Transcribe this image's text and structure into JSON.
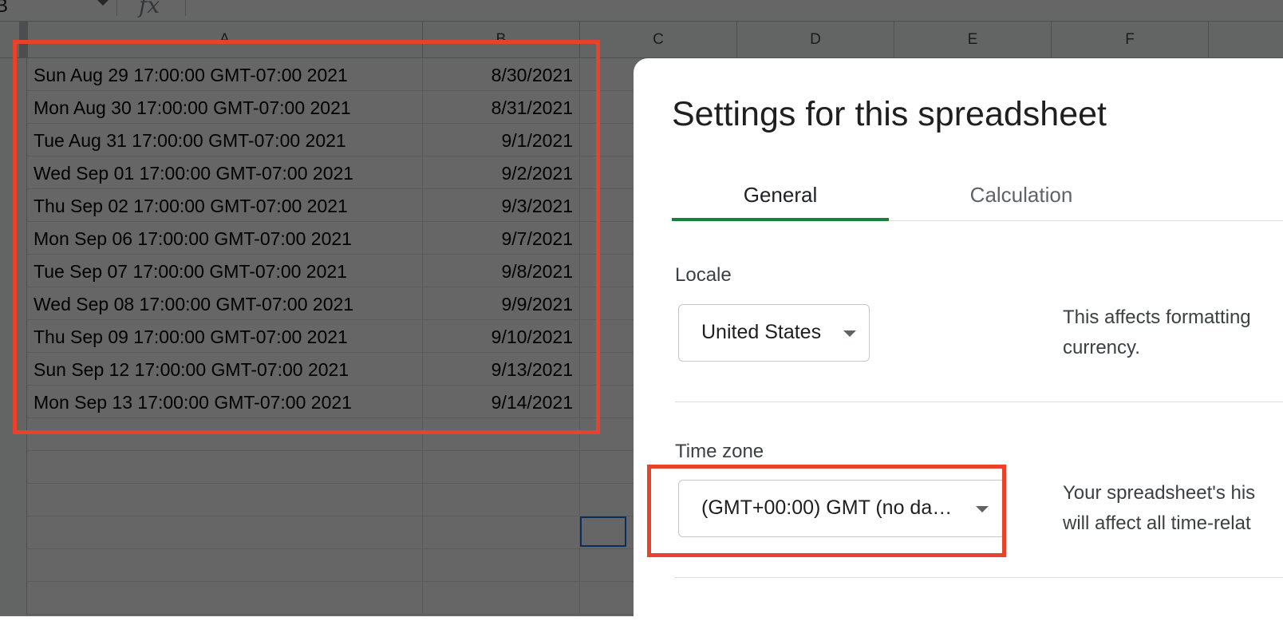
{
  "formula_bar": {
    "name_box_value": "B",
    "fx_symbol": "fx"
  },
  "columns": [
    "A",
    "B",
    "C",
    "D",
    "E",
    "F"
  ],
  "rows": [
    {
      "a": "Sun Aug 29 17:00:00 GMT-07:00 2021",
      "b": "8/30/2021"
    },
    {
      "a": "Mon Aug 30 17:00:00 GMT-07:00 2021",
      "b": "8/31/2021"
    },
    {
      "a": "Tue Aug 31 17:00:00 GMT-07:00 2021",
      "b": "9/1/2021"
    },
    {
      "a": "Wed Sep 01 17:00:00 GMT-07:00 2021",
      "b": "9/2/2021"
    },
    {
      "a": "Thu Sep 02 17:00:00 GMT-07:00 2021",
      "b": "9/3/2021"
    },
    {
      "a": "Mon Sep 06 17:00:00 GMT-07:00 2021",
      "b": "9/7/2021"
    },
    {
      "a": "Tue Sep 07 17:00:00 GMT-07:00 2021",
      "b": "9/8/2021"
    },
    {
      "a": "Wed Sep 08 17:00:00 GMT-07:00 2021",
      "b": "9/9/2021"
    },
    {
      "a": "Thu Sep 09 17:00:00 GMT-07:00 2021",
      "b": "9/10/2021"
    },
    {
      "a": "Sun Sep 12 17:00:00 GMT-07:00 2021",
      "b": "9/13/2021"
    },
    {
      "a": "Mon Sep 13 17:00:00 GMT-07:00 2021",
      "b": "9/14/2021"
    },
    {
      "a": "",
      "b": ""
    },
    {
      "a": "",
      "b": ""
    },
    {
      "a": "",
      "b": ""
    },
    {
      "a": "",
      "b": ""
    },
    {
      "a": "",
      "b": ""
    },
    {
      "a": "",
      "b": ""
    }
  ],
  "dialog": {
    "title": "Settings for this spreadsheet",
    "tabs": [
      {
        "label": "General",
        "active": true
      },
      {
        "label": "Calculation",
        "active": false
      }
    ],
    "locale": {
      "label": "Locale",
      "value": "United States",
      "description_line1": "This affects formatting",
      "description_line2": "currency."
    },
    "timezone": {
      "label": "Time zone",
      "value": "(GMT+00:00) GMT (no da…",
      "description_line1": "Your spreadsheet's his",
      "description_line2": "will affect all time-relat"
    }
  },
  "colors": {
    "highlight": "#e8432a",
    "tab_active": "#188038",
    "overlay": "rgba(0,0,0,0.6)"
  }
}
